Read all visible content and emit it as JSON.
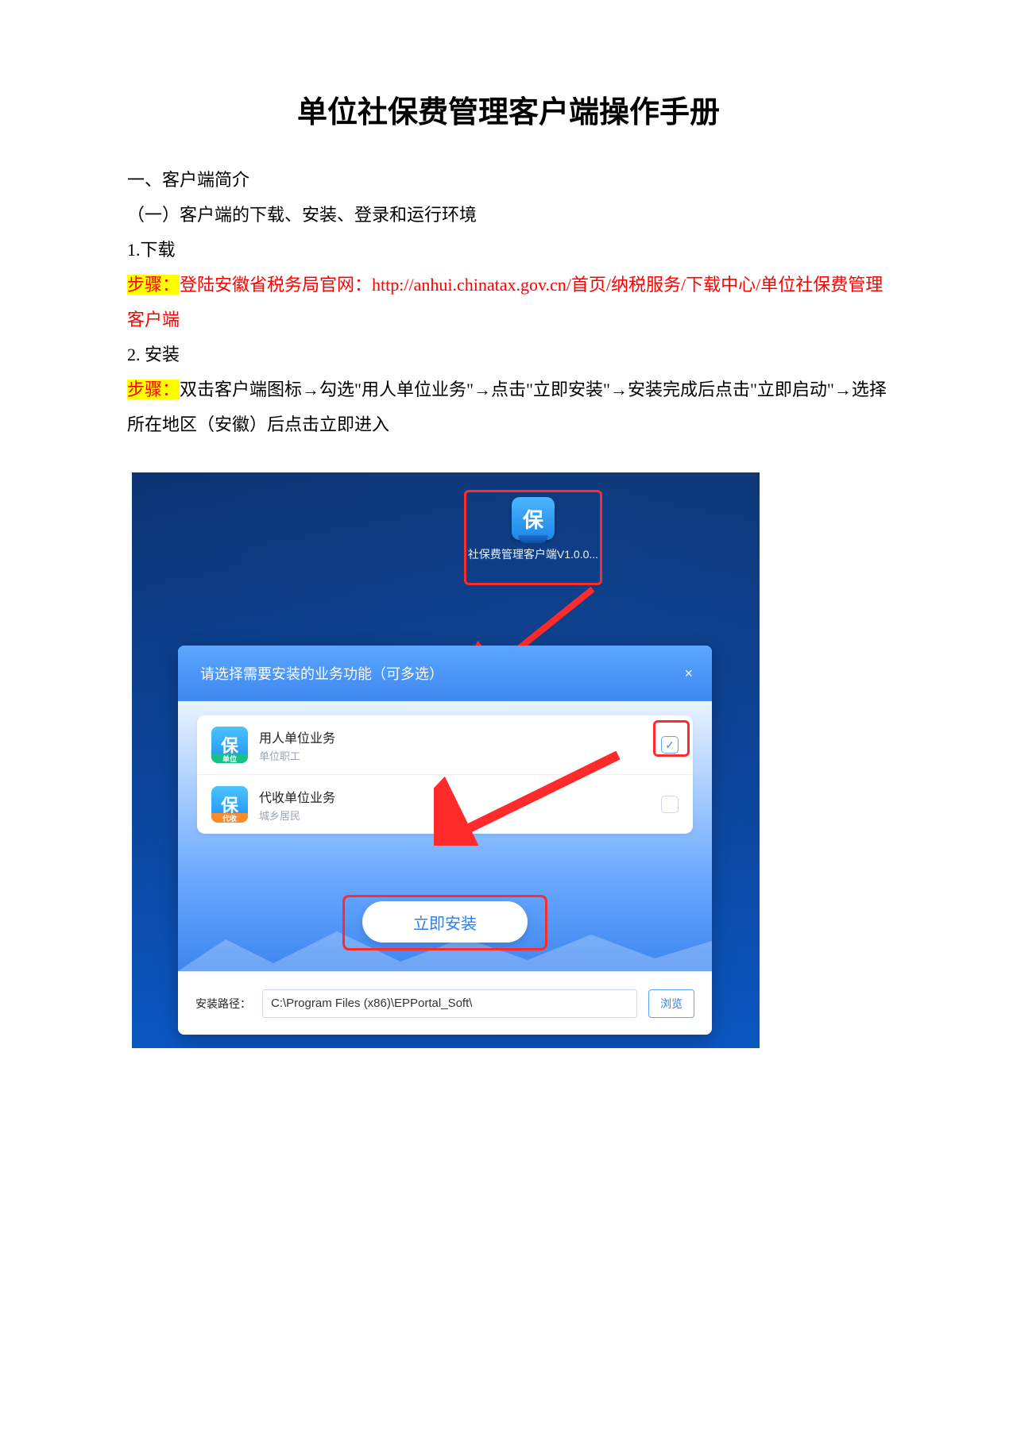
{
  "title": "单位社保费管理客户端操作手册",
  "section1": "一、客户端简介",
  "section1_1": "（一）客户端的下载、安装、登录和运行环境",
  "h_download": "1.下载",
  "step_label": "步骤：",
  "download_text": "登陆安徽省税务局官网：http://anhui.chinatax.gov.cn/首页/纳税服务/下载中心/单位社保费管理客户端",
  "h_install": "2. 安装",
  "install_step_label": "步骤：",
  "install_text": "双击客户端图标→勾选\"用人单位业务\"→点击\"立即安装\"→安装完成后点击\"立即启动\"→选择所在地区（安徽）后点击立即进入",
  "shot": {
    "desktop_icon_char": "保",
    "desktop_icon_label": "社保费管理客户端V1.0.0...",
    "panel_title": "请选择需要安装的业务功能（可多选）",
    "close_glyph": "×",
    "options": [
      {
        "name": "用人单位业务",
        "sub": "单位职工",
        "band": "单位",
        "band_class": "band-green",
        "checked": true
      },
      {
        "name": "代收单位业务",
        "sub": "城乡居民",
        "band": "代收",
        "band_class": "band-orange",
        "checked": false
      }
    ],
    "install_btn": "立即安装",
    "path_label": "安装路径：",
    "path_value": "C:\\Program Files (x86)\\EPPortal_Soft\\",
    "browse_btn": "浏览"
  }
}
